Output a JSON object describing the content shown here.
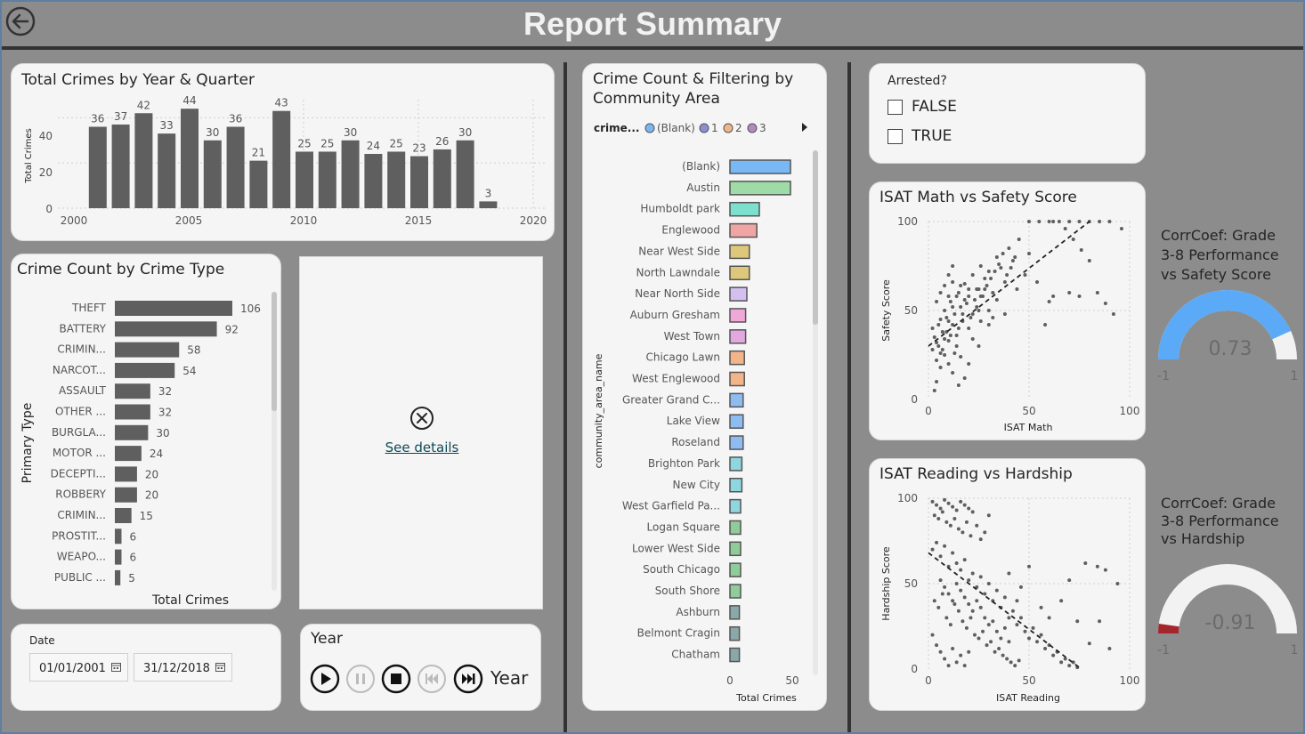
{
  "header": {
    "title": "Report Summary"
  },
  "total_crimes_year_quarter": {
    "title": "Total Crimes by Year & Quarter",
    "ylabel": "Total Crimes",
    "yticks": [
      "0",
      "20",
      "40"
    ],
    "xticks": [
      "2000",
      "2005",
      "2010",
      "2015",
      "2020"
    ]
  },
  "crime_type": {
    "title": "Crime Count by Crime Type",
    "ylabel": "Primary Type",
    "xlabel": "Total Crimes"
  },
  "details_card": {
    "link": "See details"
  },
  "community": {
    "title_line1": "Crime Count & Filtering by",
    "title_line2": "Community Area",
    "legend_title": "crime...",
    "legend_items": [
      {
        "label": "(Blank)",
        "color": "#7ab8f5"
      },
      {
        "label": "1",
        "color": "#8b8fd0"
      },
      {
        "label": "2",
        "color": "#f2b58a"
      },
      {
        "label": "3",
        "color": "#b08ac0"
      }
    ],
    "ylabel": "community_area_name",
    "xlabel": "Total Crimes",
    "xticks": [
      "0",
      "50"
    ]
  },
  "arrested": {
    "title": "Arrested?",
    "options": [
      "FALSE",
      "TRUE"
    ]
  },
  "math_safety": {
    "title": "ISAT Math vs Safety Score",
    "xlabel": "ISAT Math",
    "ylabel": "Safety Score",
    "xticks": [
      "0",
      "50",
      "100"
    ],
    "yticks": [
      "0",
      "50",
      "100"
    ]
  },
  "reading_hardship": {
    "title": "ISAT Reading vs Hardship",
    "xlabel": "ISAT Reading",
    "ylabel": "Hardship Score",
    "xticks": [
      "0",
      "50",
      "100"
    ],
    "yticks": [
      "0",
      "50",
      "100"
    ]
  },
  "gauge1": {
    "title_l1": "CorrCoef: Grade",
    "title_l2": "3-8 Performance",
    "title_l3": "vs Safety Score",
    "value_label": "0.73",
    "min": "-1",
    "max": "1"
  },
  "gauge2": {
    "title_l1": "CorrCoef: Grade",
    "title_l2": "3-8 Performance",
    "title_l3": "vs Hardship",
    "value_label": "-0.91",
    "min": "-1",
    "max": "1"
  },
  "date_slicer": {
    "label": "Date",
    "start": "01/01/2001",
    "end": "31/12/2018"
  },
  "play_axis": {
    "title": "Year",
    "field": "Year"
  },
  "chart_data": [
    {
      "type": "bar",
      "title": "Total Crimes by Year & Quarter",
      "ylabel": "Total Crimes",
      "xlim": [
        2000,
        2020
      ],
      "ylim": [
        0,
        48
      ],
      "x": [
        2001,
        2002,
        2003,
        2004,
        2005,
        2006,
        2007,
        2008,
        2009,
        2010,
        2011,
        2012,
        2013,
        2014,
        2015,
        2016,
        2017,
        2018
      ],
      "values": [
        36,
        37,
        42,
        33,
        44,
        30,
        36,
        21,
        43,
        25,
        25,
        30,
        24,
        25,
        23,
        26,
        30,
        3
      ]
    },
    {
      "type": "bar",
      "title": "Crime Count by Crime Type",
      "xlabel": "Total Crimes",
      "ylabel": "Primary Type",
      "categories": [
        "THEFT",
        "BATTERY",
        "CRIMIN...",
        "NARCOT...",
        "ASSAULT",
        "OTHER ...",
        "BURGLA...",
        "MOTOR ...",
        "DECEPTI...",
        "ROBBERY",
        "CRIMIN...",
        "PROSTIT...",
        "WEAPO...",
        "PUBLIC ..."
      ],
      "values": [
        106,
        92,
        58,
        54,
        32,
        32,
        30,
        24,
        20,
        20,
        15,
        6,
        6,
        5
      ]
    },
    {
      "type": "bar",
      "title": "Crime Count & Filtering by Community Area",
      "xlabel": "Total Crimes",
      "ylabel": "community_area_name",
      "xlim": [
        0,
        50
      ],
      "categories": [
        "(Blank)",
        "Austin",
        "Humboldt park",
        "Englewood",
        "Near West Side",
        "North Lawndale",
        "Near North Side",
        "Auburn Gresham",
        "West Town",
        "Chicago Lawn",
        "West Englewood",
        "Greater Grand C...",
        "Lake View",
        "Roseland",
        "Brighton Park",
        "New City",
        "West Garfield Pa...",
        "Logan Square",
        "Lower West Side",
        "South Chicago",
        "South Shore",
        "Ashburn",
        "Belmont Cragin",
        "Chatham"
      ],
      "values": [
        50,
        50,
        25,
        23,
        17,
        17,
        15,
        14,
        14,
        13,
        13,
        12,
        12,
        12,
        11,
        11,
        10,
        10,
        10,
        10,
        10,
        9,
        9,
        9
      ],
      "colors": [
        "#7ab8f5",
        "#9edba6",
        "#7de0cf",
        "#f0a5a5",
        "#dcc77a",
        "#dcc77a",
        "#d3c0f0",
        "#f0a8d8",
        "#e3a8e0",
        "#f2b58a",
        "#f2b58a",
        "#8fbcf0",
        "#8fbcf0",
        "#8fbcf0",
        "#8fd6e0",
        "#8fd6e0",
        "#8fd6e0",
        "#8fcc9a",
        "#8fcc9a",
        "#8fcc9a",
        "#8fcc9a",
        "#8aa8a8",
        "#8aa8a8",
        "#8aa8a8"
      ]
    },
    {
      "type": "scatter",
      "title": "ISAT Math vs Safety Score",
      "xlabel": "ISAT Math",
      "ylabel": "Safety Score",
      "xlim": [
        0,
        100
      ],
      "ylim": [
        0,
        100
      ],
      "trend": [
        [
          0,
          30
        ],
        [
          80,
          100
        ]
      ],
      "points": [
        [
          2,
          40
        ],
        [
          3,
          35
        ],
        [
          4,
          22
        ],
        [
          5,
          30
        ],
        [
          6,
          45
        ],
        [
          7,
          28
        ],
        [
          8,
          50
        ],
        [
          9,
          38
        ],
        [
          10,
          33
        ],
        [
          11,
          55
        ],
        [
          12,
          42
        ],
        [
          13,
          48
        ],
        [
          14,
          36
        ],
        [
          15,
          60
        ],
        [
          16,
          52
        ],
        [
          17,
          44
        ],
        [
          18,
          65
        ],
        [
          20,
          58
        ],
        [
          22,
          70
        ],
        [
          24,
          62
        ],
        [
          25,
          50
        ],
        [
          26,
          75
        ],
        [
          28,
          68
        ],
        [
          30,
          72
        ],
        [
          32,
          60
        ],
        [
          34,
          80
        ],
        [
          36,
          74
        ],
        [
          38,
          66
        ],
        [
          40,
          85
        ],
        [
          42,
          78
        ],
        [
          45,
          90
        ],
        [
          48,
          70
        ],
        [
          50,
          100
        ],
        [
          55,
          100
        ],
        [
          60,
          100
        ],
        [
          62,
          100
        ],
        [
          65,
          100
        ],
        [
          70,
          100
        ],
        [
          75,
          100
        ],
        [
          80,
          100
        ],
        [
          85,
          100
        ],
        [
          90,
          100
        ],
        [
          4,
          10
        ],
        [
          6,
          18
        ],
        [
          8,
          25
        ],
        [
          10,
          20
        ],
        [
          12,
          15
        ],
        [
          3,
          5
        ],
        [
          14,
          30
        ],
        [
          16,
          24
        ],
        [
          20,
          40
        ],
        [
          18,
          12
        ],
        [
          22,
          34
        ],
        [
          26,
          44
        ],
        [
          30,
          50
        ],
        [
          34,
          56
        ],
        [
          6,
          60
        ],
        [
          8,
          64
        ],
        [
          10,
          70
        ],
        [
          12,
          75
        ],
        [
          4,
          55
        ],
        [
          38,
          48
        ],
        [
          44,
          62
        ],
        [
          50,
          82
        ],
        [
          54,
          66
        ],
        [
          58,
          42
        ],
        [
          62,
          58
        ],
        [
          68,
          96
        ],
        [
          72,
          90
        ],
        [
          76,
          84
        ],
        [
          80,
          78
        ],
        [
          84,
          60
        ],
        [
          88,
          54
        ],
        [
          92,
          48
        ],
        [
          96,
          96
        ],
        [
          70,
          60
        ],
        [
          75,
          58
        ],
        [
          60,
          55
        ],
        [
          5,
          42
        ],
        [
          7,
          38
        ],
        [
          9,
          46
        ],
        [
          11,
          36
        ],
        [
          13,
          26
        ],
        [
          15,
          40
        ],
        [
          17,
          48
        ],
        [
          19,
          54
        ],
        [
          21,
          46
        ],
        [
          23,
          56
        ],
        [
          25,
          62
        ],
        [
          27,
          58
        ],
        [
          29,
          64
        ],
        [
          31,
          68
        ],
        [
          33,
          72
        ],
        [
          35,
          76
        ],
        [
          37,
          82
        ],
        [
          39,
          70
        ],
        [
          41,
          74
        ],
        [
          43,
          80
        ],
        [
          2,
          28
        ],
        [
          4,
          32
        ],
        [
          6,
          26
        ],
        [
          8,
          34
        ],
        [
          10,
          44
        ],
        [
          12,
          52
        ],
        [
          14,
          58
        ],
        [
          16,
          64
        ],
        [
          18,
          56
        ],
        [
          20,
          62
        ],
        [
          22,
          48
        ],
        [
          24,
          52
        ],
        [
          26,
          58
        ],
        [
          28,
          62
        ],
        [
          30,
          42
        ],
        [
          32,
          46
        ],
        [
          15,
          8
        ],
        [
          20,
          20
        ],
        [
          25,
          30
        ],
        [
          10,
          58
        ],
        [
          12,
          66
        ]
      ]
    },
    {
      "type": "scatter",
      "title": "ISAT Reading vs Hardship",
      "xlabel": "ISAT Reading",
      "ylabel": "Hardship Score",
      "xlim": [
        0,
        100
      ],
      "ylim": [
        0,
        100
      ],
      "trend": [
        [
          0,
          68
        ],
        [
          76,
          0
        ]
      ],
      "points": [
        [
          2,
          98
        ],
        [
          4,
          96
        ],
        [
          6,
          94
        ],
        [
          8,
          99
        ],
        [
          10,
          97
        ],
        [
          12,
          95
        ],
        [
          14,
          93
        ],
        [
          16,
          98
        ],
        [
          18,
          96
        ],
        [
          20,
          94
        ],
        [
          22,
          92
        ],
        [
          3,
          90
        ],
        [
          5,
          88
        ],
        [
          7,
          92
        ],
        [
          9,
          86
        ],
        [
          11,
          84
        ],
        [
          13,
          88
        ],
        [
          15,
          82
        ],
        [
          17,
          80
        ],
        [
          19,
          86
        ],
        [
          21,
          78
        ],
        [
          24,
          84
        ],
        [
          26,
          76
        ],
        [
          28,
          80
        ],
        [
          30,
          90
        ],
        [
          2,
          70
        ],
        [
          4,
          74
        ],
        [
          6,
          66
        ],
        [
          8,
          72
        ],
        [
          10,
          60
        ],
        [
          12,
          68
        ],
        [
          14,
          62
        ],
        [
          16,
          58
        ],
        [
          18,
          64
        ],
        [
          20,
          52
        ],
        [
          22,
          56
        ],
        [
          24,
          48
        ],
        [
          26,
          54
        ],
        [
          28,
          44
        ],
        [
          30,
          50
        ],
        [
          32,
          40
        ],
        [
          34,
          46
        ],
        [
          36,
          36
        ],
        [
          38,
          42
        ],
        [
          40,
          30
        ],
        [
          42,
          34
        ],
        [
          44,
          26
        ],
        [
          46,
          30
        ],
        [
          48,
          22
        ],
        [
          50,
          18
        ],
        [
          52,
          24
        ],
        [
          54,
          16
        ],
        [
          56,
          20
        ],
        [
          58,
          12
        ],
        [
          60,
          14
        ],
        [
          62,
          8
        ],
        [
          64,
          10
        ],
        [
          66,
          4
        ],
        [
          68,
          6
        ],
        [
          70,
          2
        ],
        [
          72,
          4
        ],
        [
          74,
          1
        ],
        [
          3,
          40
        ],
        [
          5,
          36
        ],
        [
          7,
          44
        ],
        [
          9,
          30
        ],
        [
          11,
          26
        ],
        [
          13,
          38
        ],
        [
          15,
          34
        ],
        [
          17,
          28
        ],
        [
          19,
          24
        ],
        [
          21,
          30
        ],
        [
          23,
          20
        ],
        [
          25,
          18
        ],
        [
          27,
          22
        ],
        [
          29,
          14
        ],
        [
          31,
          16
        ],
        [
          33,
          10
        ],
        [
          35,
          12
        ],
        [
          37,
          8
        ],
        [
          39,
          6
        ],
        [
          41,
          4
        ],
        [
          43,
          2
        ],
        [
          45,
          5
        ],
        [
          2,
          20
        ],
        [
          4,
          14
        ],
        [
          6,
          10
        ],
        [
          8,
          6
        ],
        [
          10,
          2
        ],
        [
          12,
          12
        ],
        [
          14,
          4
        ],
        [
          16,
          8
        ],
        [
          18,
          2
        ],
        [
          20,
          10
        ],
        [
          6,
          52
        ],
        [
          8,
          48
        ],
        [
          10,
          44
        ],
        [
          12,
          40
        ],
        [
          14,
          50
        ],
        [
          16,
          46
        ],
        [
          18,
          42
        ],
        [
          20,
          38
        ],
        [
          22,
          34
        ],
        [
          24,
          40
        ],
        [
          26,
          36
        ],
        [
          28,
          30
        ],
        [
          30,
          26
        ],
        [
          32,
          28
        ],
        [
          34,
          22
        ],
        [
          36,
          18
        ],
        [
          38,
          24
        ],
        [
          40,
          16
        ],
        [
          78,
          62
        ],
        [
          84,
          60
        ],
        [
          88,
          58
        ],
        [
          94,
          50
        ],
        [
          80,
          15
        ],
        [
          90,
          12
        ],
        [
          85,
          28
        ],
        [
          74,
          28
        ],
        [
          66,
          40
        ],
        [
          70,
          52
        ],
        [
          50,
          60
        ],
        [
          46,
          48
        ],
        [
          56,
          36
        ],
        [
          60,
          30
        ],
        [
          40,
          56
        ],
        [
          44,
          40
        ]
      ]
    },
    {
      "type": "gauge",
      "title": "CorrCoef: Grade 3-8 Performance vs Safety Score",
      "value": 0.73,
      "min": -1,
      "max": 1
    },
    {
      "type": "gauge",
      "title": "CorrCoef: Grade 3-8 Performance vs Hardship",
      "value": -0.91,
      "min": -1,
      "max": 1
    }
  ],
  "colors": {
    "bar": "#5f5f5f",
    "gauge_safety": "#5aaaf7",
    "gauge_hardship": "#a4262c",
    "gauge_track": "#e8e8e8",
    "link": "#0d4a55"
  }
}
